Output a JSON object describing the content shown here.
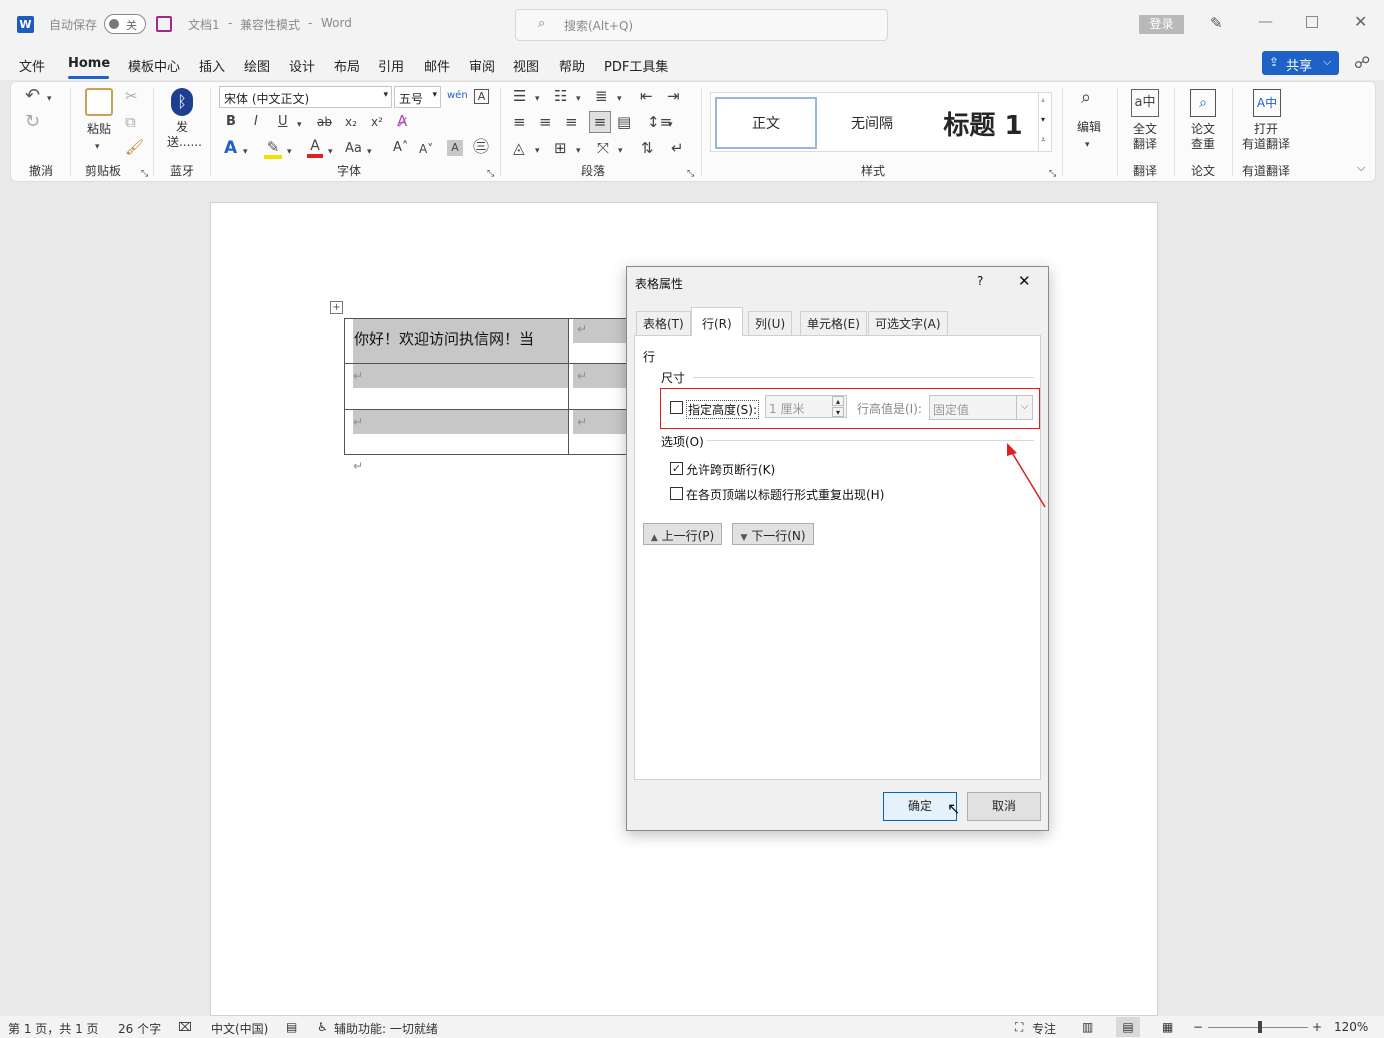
{
  "titlebar": {
    "autosave_label": "自动保存",
    "autosave_state": "关",
    "doc_title": "文档1",
    "separator1": "-",
    "compat_mode": "兼容性模式",
    "separator2": "-",
    "app_name": "Word",
    "search_placeholder": "搜索(Alt+Q)",
    "login_label": "登录"
  },
  "menu": {
    "tabs": [
      "文件",
      "Home",
      "模板中心",
      "插入",
      "绘图",
      "设计",
      "布局",
      "引用",
      "邮件",
      "审阅",
      "视图",
      "帮助",
      "PDF工具集"
    ],
    "share_label": "共享"
  },
  "ribbon": {
    "undo_group": "撤消",
    "clipboard": {
      "paste_label": "粘贴",
      "group_label": "剪贴板"
    },
    "bluetooth": {
      "send_label_1": "发",
      "send_label_2": "送......",
      "group_label": "蓝牙"
    },
    "font": {
      "font_name": "宋体 (中文正文)",
      "font_size": "五号",
      "group_label": "字体",
      "aa_label": "Aa"
    },
    "paragraph": {
      "group_label": "段落"
    },
    "styles": {
      "items": [
        "正文",
        "无间隔",
        "标题 1"
      ],
      "group_label": "样式"
    },
    "editing": {
      "label": "编辑"
    },
    "translate": {
      "full_label_1": "全文",
      "full_label_2": "翻译",
      "group_label": "翻译"
    },
    "paper": {
      "label_1": "论文",
      "label_2": "查重",
      "group_label": "论文"
    },
    "youdao": {
      "label_1": "打开",
      "label_2": "有道翻译",
      "group_label": "有道翻译"
    }
  },
  "document": {
    "cell_text": "你好！欢迎访问执信网！当",
    "para_mark": "↵"
  },
  "dialog": {
    "title": "表格属性",
    "help": "?",
    "tabs": [
      "表格(T)",
      "行(R)",
      "列(U)",
      "单元格(E)",
      "可选文字(A)"
    ],
    "section_row": "行",
    "size_label": "尺寸",
    "specify_height_label": "指定高度(S):",
    "specify_height_checked": false,
    "height_value": "1 厘米",
    "row_height_is_label": "行高值是(I):",
    "row_height_mode": "固定值",
    "options_label": "选项(O)",
    "allow_break_label": "允许跨页断行(K)",
    "allow_break_checked": true,
    "repeat_header_label": "在各页顶端以标题行形式重复出现(H)",
    "repeat_header_checked": false,
    "prev_row_label": "上一行(P)",
    "next_row_label": "下一行(N)",
    "ok_label": "确定",
    "cancel_label": "取消",
    "annotation_color": "#e02020"
  },
  "statusbar": {
    "page_info": "第 1 页，共 1 页",
    "word_count": "26 个字",
    "language": "中文(中国)",
    "accessibility": "辅助功能: 一切就绪",
    "focus_label": "专注",
    "zoom": "120%"
  }
}
